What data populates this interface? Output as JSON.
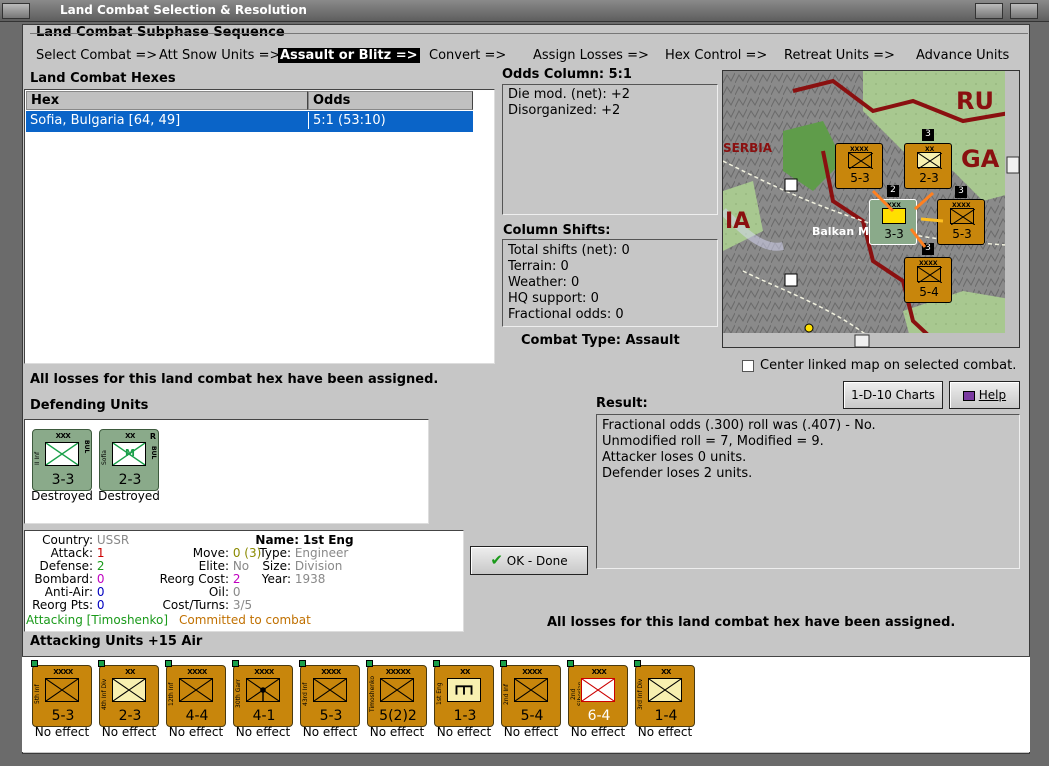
{
  "window": {
    "title": "Land Combat Selection & Resolution"
  },
  "subphase": {
    "heading": "Land Combat Subphase Sequence",
    "steps": [
      "Select Combat =>",
      "Att Snow Units =>",
      "Assault or Blitz =>",
      "Convert =>",
      "Assign Losses =>",
      "Hex Control =>",
      "Retreat Units =>",
      "Advance Units"
    ],
    "selected_index": 2
  },
  "hexes": {
    "heading": "Land Combat Hexes",
    "columns": [
      "Hex",
      "Odds"
    ],
    "rows": [
      {
        "hex": "Sofia, Bulgaria [64, 49]",
        "odds": "5:1 (53:10)"
      }
    ]
  },
  "odds": {
    "heading": "Odds Column: 5:1",
    "lines": [
      "Die mod. (net): +2",
      "Disorganized: +2"
    ]
  },
  "shifts": {
    "heading": "Column Shifts:",
    "lines": [
      "Total shifts (net): 0",
      "Terrain: 0",
      "Weather: 0",
      "HQ support: 0",
      "Fractional odds: 0"
    ]
  },
  "combat_type": "Combat Type:  Assault",
  "map": {
    "labels": [
      "RU",
      "SERBIA",
      "GA",
      "IA",
      "Balkan M"
    ],
    "center_linked_label": "Center linked map on selected combat.",
    "center_linked_checked": false,
    "counters": [
      {
        "name": "5th Inf",
        "size": "XXXX",
        "str": "5-3"
      },
      {
        "name": "41st Inf",
        "size": "XX",
        "str": "2-3"
      },
      {
        "name": "II Inf",
        "size": "XXX",
        "str": "3-3"
      },
      {
        "name": "41st Inf",
        "size": "XXXX",
        "str": "5-3"
      },
      {
        "name": "2nd Inf",
        "size": "XXXX",
        "str": "5-4"
      }
    ],
    "stack_counts": [
      "3",
      "2",
      "3",
      "3"
    ]
  },
  "messages": {
    "losses_assigned_top": "All losses for this land combat hex have been assigned.",
    "losses_assigned_bottom": "All losses for this land combat hex have been assigned."
  },
  "buttons": {
    "charts": "1-D-10 Charts",
    "help": "Help",
    "ok": "OK - Done"
  },
  "defending": {
    "heading": "Defending Units",
    "units": [
      {
        "name": "II Inf",
        "size": "XXX",
        "side": "BUL",
        "str": "3-3",
        "status": "Destroyed",
        "sym": "inf"
      },
      {
        "name": "Sofia",
        "size": "XX",
        "side": "BUL",
        "side_top": "R",
        "str": "2-3",
        "status": "Destroyed",
        "sym": "mil",
        "sym_text": "M"
      }
    ]
  },
  "result": {
    "heading": "Result:",
    "lines": [
      "Fractional odds (.300) roll was (.407)  - No.",
      "Unmodified roll = 7, Modified = 9.",
      "Attacker loses 0 units.",
      "Defender loses 2 units."
    ]
  },
  "info": {
    "country_k": "Country:",
    "country_v": "USSR",
    "attack_k": "Attack:",
    "attack_v": "1",
    "defense_k": "Defense:",
    "defense_v": "2",
    "bombard_k": "Bombard:",
    "bombard_v": "0",
    "antiair_k": "Anti-Air:",
    "antiair_v": "0",
    "reorg_k": "Reorg Pts:",
    "reorg_v": "0",
    "move_k": "Move:",
    "move_v": "0",
    "move_v2": "(3)",
    "elite_k": "Elite:",
    "elite_v": "No",
    "reorgcost_k": "Reorg Cost:",
    "reorgcost_v": "2",
    "oil_k": "Oil:",
    "oil_v": "0",
    "cost_k": "Cost/Turns:",
    "cost_v": "3/5",
    "name_k": "Name:",
    "name_v": "1st Eng",
    "type_k": "Type:",
    "type_v": "Engineer",
    "size_k": "Size:",
    "size_v": "Division",
    "year_k": "Year:",
    "year_v": "1938",
    "attacking": "Attacking [Timoshenko]",
    "committed": "Committed to combat"
  },
  "attacking": {
    "heading": "Attacking Units +15 Air",
    "units": [
      {
        "name": "5th Inf",
        "size": "XXXX",
        "str": "5-3",
        "status": "No effect",
        "sym": "inf"
      },
      {
        "name": "4th Inf Div",
        "size": "XX",
        "str": "2-3",
        "status": "No effect",
        "sym": "inf",
        "light": true
      },
      {
        "name": "12th Inf",
        "size": "XXXX",
        "str": "4-4",
        "status": "No effect",
        "sym": "inf"
      },
      {
        "name": "30th Garr",
        "size": "XXXX",
        "str": "4-1",
        "status": "No effect",
        "sym": "garr"
      },
      {
        "name": "43rd Inf",
        "size": "XXXX",
        "str": "5-3",
        "status": "No effect",
        "sym": "inf"
      },
      {
        "name": "Timoshenko",
        "size": "XXXXX",
        "str": "5(2)2",
        "status": "No effect",
        "sym": "hq"
      },
      {
        "name": "1st Eng",
        "size": "XX",
        "str": "1-3",
        "status": "No effect",
        "sym": "eng",
        "light": true
      },
      {
        "name": "2nd Inf",
        "size": "XXXX",
        "str": "5-4",
        "status": "No effect",
        "sym": "inf"
      },
      {
        "name": "2nd Siberian",
        "size": "XXX",
        "str": "6-4",
        "status": "No effect",
        "sym": "inf",
        "white": true
      },
      {
        "name": "3rd Inf Div",
        "size": "XX",
        "str": "1-4",
        "status": "No effect",
        "sym": "inf",
        "light": true
      }
    ]
  },
  "colors": {
    "ussr": "#c8860c",
    "bulgaria": "#8aaa8a",
    "selection": "#0a64c8"
  }
}
